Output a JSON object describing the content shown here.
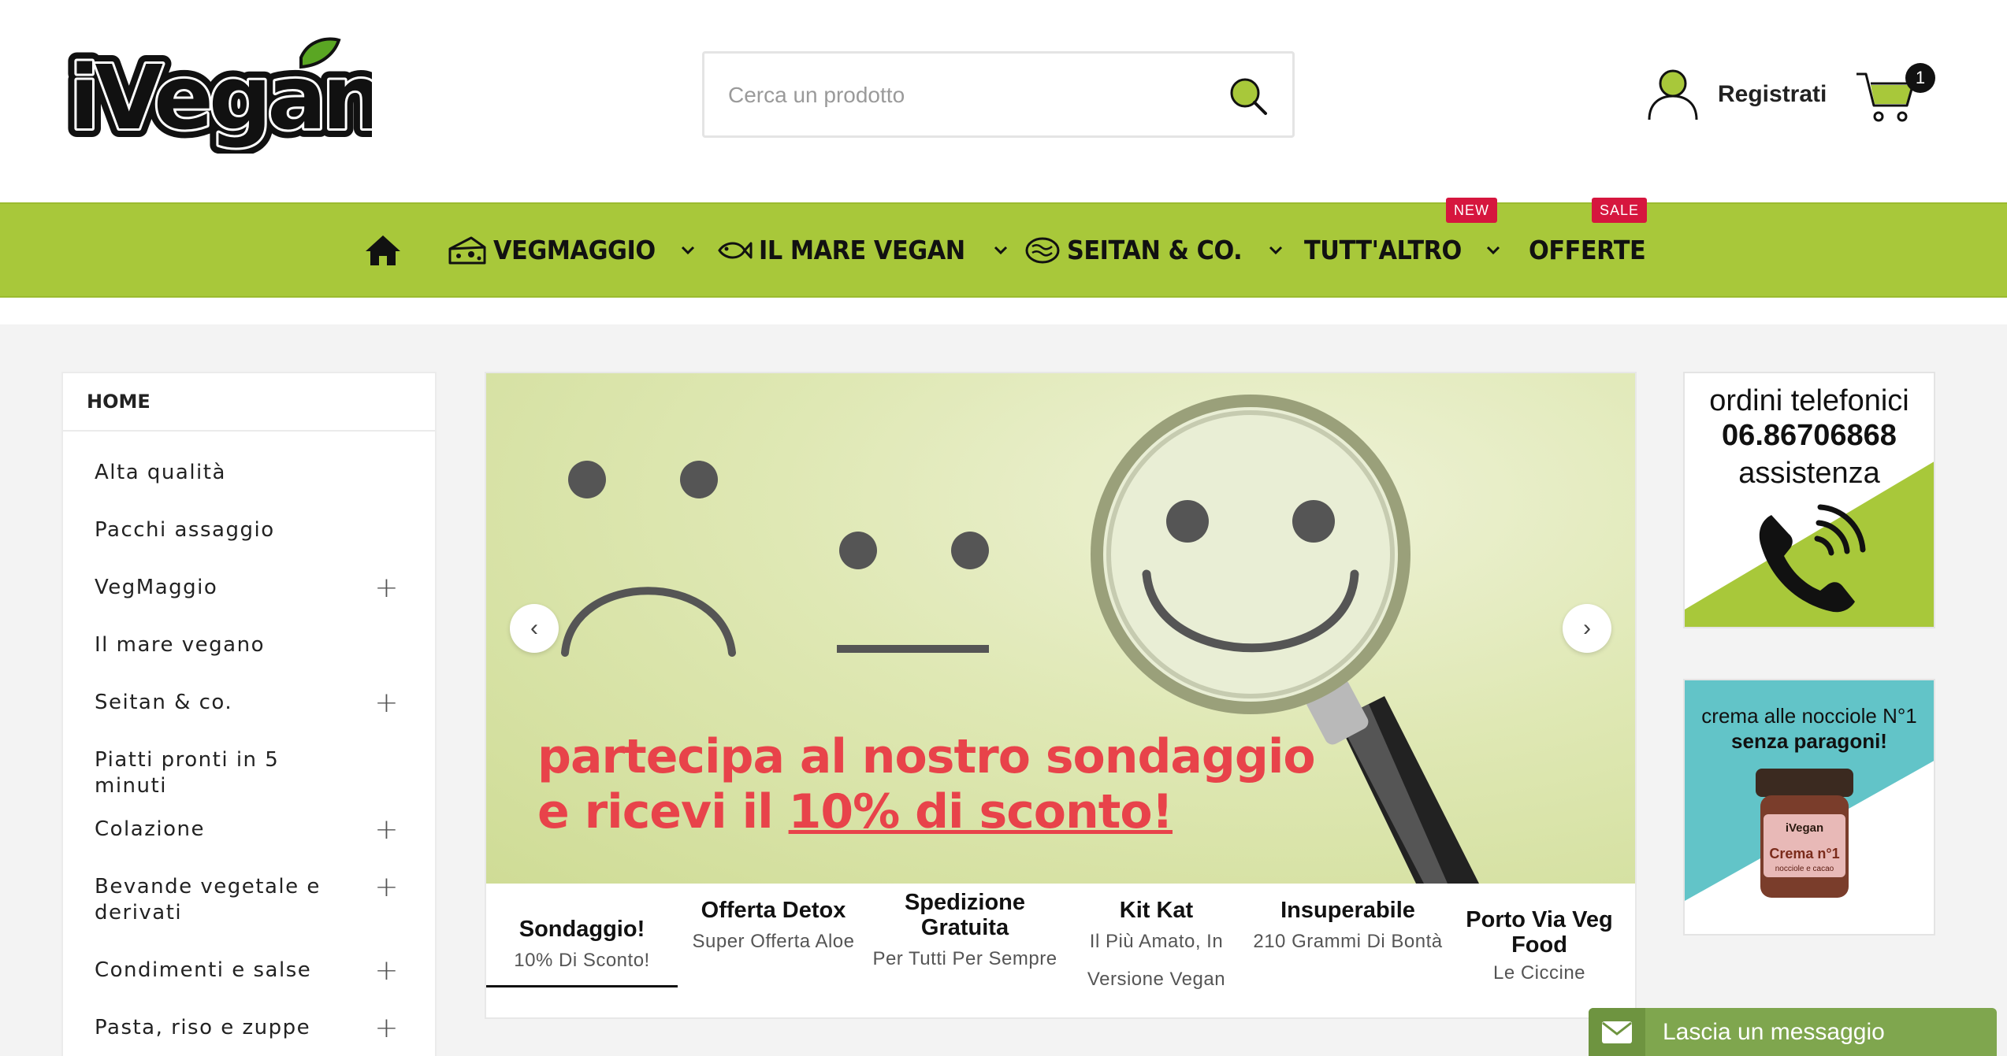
{
  "header": {
    "logo_text": "iVegan",
    "search_placeholder": "Cerca un prodotto",
    "register_label": "Registrati",
    "cart_count": "1"
  },
  "nav": {
    "items": [
      {
        "label": "VEGMAGGIO",
        "icon": "cheese-icon"
      },
      {
        "label": "IL MARE VEGAN",
        "icon": "fish-icon"
      },
      {
        "label": "SEITAN & CO.",
        "icon": "seitan-icon"
      },
      {
        "label": "TUTT'ALTRO",
        "tag": "NEW"
      },
      {
        "label": "OFFERTE",
        "tag": "SALE"
      }
    ]
  },
  "sidebar": {
    "title": "HOME",
    "items": [
      {
        "label": "Alta qualità"
      },
      {
        "label": "Pacchi assaggio"
      },
      {
        "label": "VegMaggio",
        "plus": "+"
      },
      {
        "label": "Il mare vegano"
      },
      {
        "label": "Seitan & co.",
        "plus": "+"
      },
      {
        "label": "Piatti pronti in 5 minuti"
      },
      {
        "label": "Colazione",
        "plus": "+"
      },
      {
        "label": "Bevande vegetale e derivati",
        "plus": "+"
      },
      {
        "label": "Condimenti e salse",
        "plus": "+"
      },
      {
        "label": "Pasta, riso e zuppe",
        "plus": "+"
      }
    ]
  },
  "banner": {
    "line1": "partecipa al nostro sondaggio",
    "line2_prefix": "e ricevi il ",
    "line2_highlight": "10% di sconto!",
    "prev": "‹",
    "next": "›"
  },
  "tabs": [
    {
      "title": "Sondaggio!",
      "subtitle": "10% Di Sconto!"
    },
    {
      "title": "Offerta Detox",
      "subtitle": "Super Offerta Aloe"
    },
    {
      "title": "Spedizione Gratuita",
      "subtitle": "Per Tutti Per Sempre"
    },
    {
      "title": "Kit Kat",
      "subtitle": "Il Più Amato, In Versione Vegan"
    },
    {
      "title": "Insuperabile",
      "subtitle": "210 Grammi Di Bontà"
    },
    {
      "title": "Porto Via Veg Food",
      "subtitle": "Le Ciccine"
    }
  ],
  "ads": {
    "phone": {
      "line1": "ordini telefonici",
      "number": "06.86706868",
      "line3": "assistenza"
    },
    "cream": {
      "line1": "crema alle nocciole N°1",
      "line2": "senza paragoni!",
      "jar_brand": "iVegan",
      "jar_label": "Crema n°1",
      "jar_sub": "nocciole e cacao"
    }
  },
  "chat": {
    "label": "Lascia un messaggio"
  },
  "colors": {
    "nav_green": "#a8c83a",
    "sale_red": "#d6163e",
    "banner_text": "#e8434a",
    "chat_green": "#7fa64e"
  }
}
